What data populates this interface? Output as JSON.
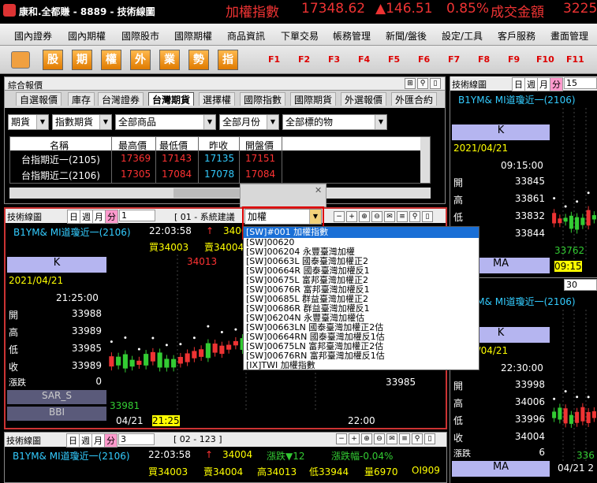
{
  "titlebar": {
    "app_title": "康和.全都賺 - 8889 - 技術線圖",
    "index_name": "加權指數",
    "index_value": "17348.62",
    "index_change": "▲146.51",
    "index_pct": "0.85%",
    "vol_label": "成交金額",
    "vol_value": "3225"
  },
  "menu": [
    "國內證券",
    "國內期權",
    "國際股市",
    "國際期權",
    "商品資訊",
    "下單交易",
    "帳務管理",
    "新聞/盤後",
    "設定/工具",
    "客戶服務",
    "畫面管理"
  ],
  "toolbar": {
    "buttons": [
      "股",
      "期",
      "權",
      "外",
      "業",
      "勢",
      "指"
    ],
    "fkeys": [
      "F1",
      "F2",
      "F3",
      "F4",
      "F5",
      "F6",
      "F7",
      "F8",
      "F9",
      "F10",
      "F11"
    ]
  },
  "quote_panel": {
    "title": "綜合報價",
    "tabs": [
      "自選報價",
      "庫存",
      "台灣證券",
      "台灣期貨",
      "選擇權",
      "國際指數",
      "國際期貨",
      "外選報價",
      "外匯合約"
    ],
    "filters": [
      "期貨",
      "指數期貨",
      "全部商品",
      "全部月份",
      "全部標的物"
    ],
    "columns": [
      "名稱",
      "最高價",
      "最低價",
      "昨收",
      "開盤價"
    ],
    "rows": [
      [
        "台指期近一(2105)",
        "17369",
        "17143",
        "17135",
        "17151"
      ],
      [
        "台指期近二(2106)",
        "17305",
        "17084",
        "17078",
        "17084"
      ]
    ]
  },
  "chart1": {
    "title": "技術線圖",
    "period": [
      "日",
      "週",
      "月",
      "分"
    ],
    "interval": "1",
    "caption": "[ 01 - 系統建議",
    "symbol": "B1YM& MI道瓊近一(2106)",
    "time": "22:03:58",
    "arrow": "↑",
    "price": "34004",
    "bid": "買34003",
    "ask": "賣34004",
    "k_label": "K",
    "date": "2021/04/21",
    "bar_time": "21:25:00",
    "ohlc": [
      [
        "開",
        "33988"
      ],
      [
        "高",
        "33989"
      ],
      [
        "低",
        "33985"
      ],
      [
        "收",
        "33989"
      ],
      [
        "漲跌",
        "0"
      ]
    ],
    "indicators": [
      "SAR_S",
      "BBI"
    ],
    "hi_label": "34013",
    "lo_label": "33981",
    "right_label": "33985",
    "x_labels": [
      "04/21",
      "21:25",
      "22:00"
    ]
  },
  "chart2": {
    "title": "技術線圖",
    "period": [
      "日",
      "週",
      "月",
      "分"
    ],
    "interval": "3",
    "caption": "[ 02 - 123 ]",
    "symbol": "B1YM& MI道瓊近一(2106)",
    "time": "22:03:58",
    "arrow": "↑",
    "price": "34004",
    "change": "漲跌▼12",
    "pct": "漲跌幅-0.04%",
    "bid": "買34003",
    "ask": "賣34004",
    "high": "高34013",
    "low": "低33944",
    "vol": "量6970",
    "oi": "OI909"
  },
  "chart3": {
    "title": "技術線圖",
    "period": [
      "日",
      "週",
      "月",
      "分"
    ],
    "interval": "15",
    "symbol": "B1YM& MI道瓊近一(2106)",
    "k_label": "K",
    "date": "2021/04/21",
    "bar_time": "09:15:00",
    "ohlc": [
      [
        "開",
        "33845"
      ],
      [
        "高",
        "33861"
      ],
      [
        "低",
        "33832"
      ],
      [
        "收",
        "33844"
      ]
    ],
    "ma_label": "MA",
    "time_label": "09:15",
    "lo_label": "33762"
  },
  "chart4": {
    "interval": "30",
    "symbol": "B1YM& MI道瓊近一(2106)",
    "k_label": "K",
    "date": "2021/04/21",
    "bar_time": "22:30:00",
    "ohlc": [
      [
        "開",
        "33998"
      ],
      [
        "高",
        "34006"
      ],
      [
        "低",
        "33996"
      ],
      [
        "收",
        "34004"
      ],
      [
        "漲跌",
        "6"
      ]
    ],
    "ma_label": "MA",
    "x_label": "04/21 2",
    "lo_label": "336"
  },
  "combo": {
    "value": "加權",
    "selected": "[SW]#001    加權指數",
    "items": [
      "[SW]00620",
      "[SW]006204  永豐臺灣加權",
      "[SW]00663L  國泰臺灣加權正2",
      "[SW]00664R  國泰臺灣加權反1",
      "[SW]00675L  富邦臺灣加權正2",
      "[SW]00676R  富邦臺灣加權反1",
      "[SW]00685L  群益臺灣加權正2",
      "[SW]00686R  群益臺灣加權反1",
      "[SW]06204N  永豐臺灣加權估",
      "[SW]00663LN 國泰臺灣加權正2估",
      "[SW]00664RN 國泰臺灣加權反1估",
      "[SW]00675LN 富邦臺灣加權正2估",
      "[SW]00676RN 富邦臺灣加權反1估",
      "[IX]TWI     加權指數"
    ]
  }
}
